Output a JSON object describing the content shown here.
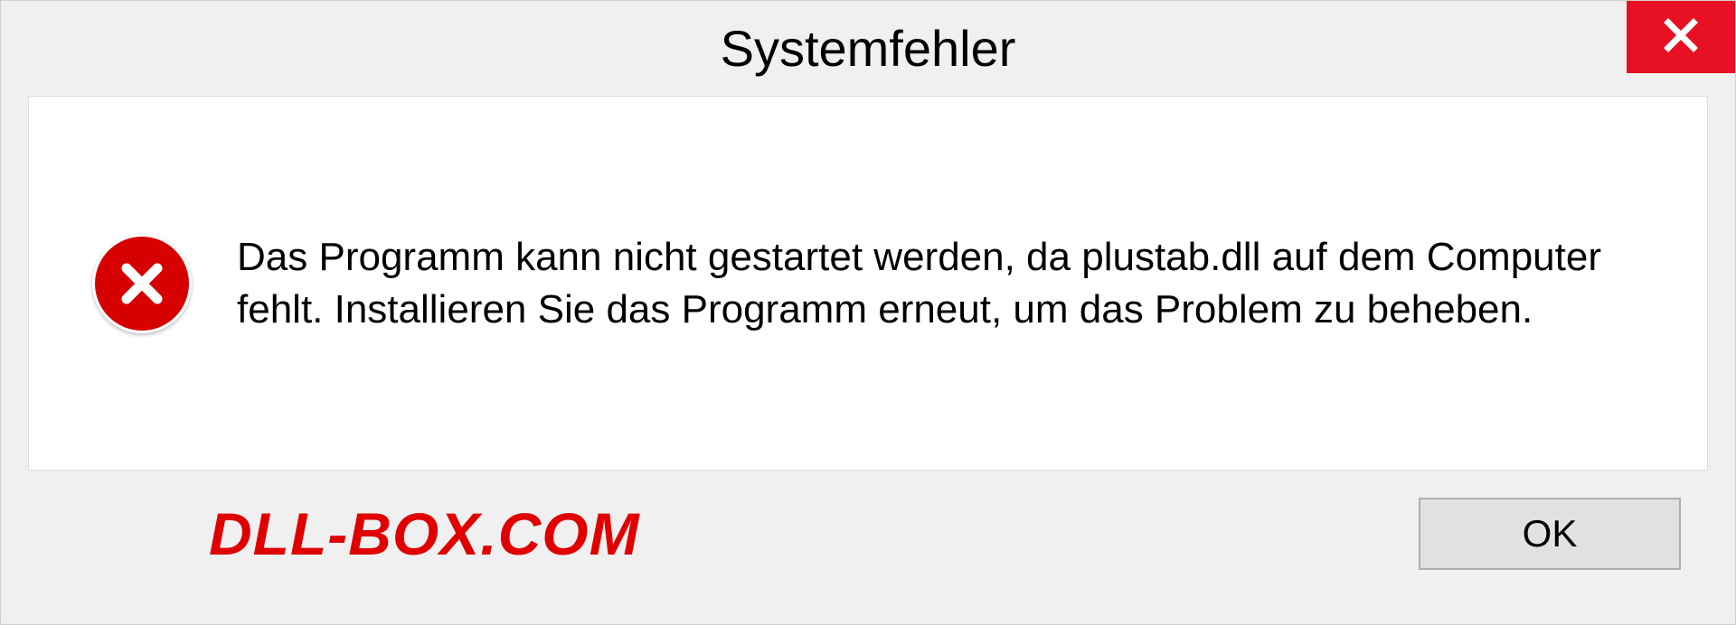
{
  "dialog": {
    "title": "Systemfehler",
    "message": "Das Programm kann nicht gestartet werden, da plustab.dll auf dem Computer fehlt. Installieren Sie das Programm erneut, um das Problem zu beheben.",
    "ok_label": "OK"
  },
  "watermark": "DLL-BOX.COM",
  "colors": {
    "close_bg": "#e81123",
    "error_icon": "#d70000",
    "watermark": "#e00000"
  }
}
